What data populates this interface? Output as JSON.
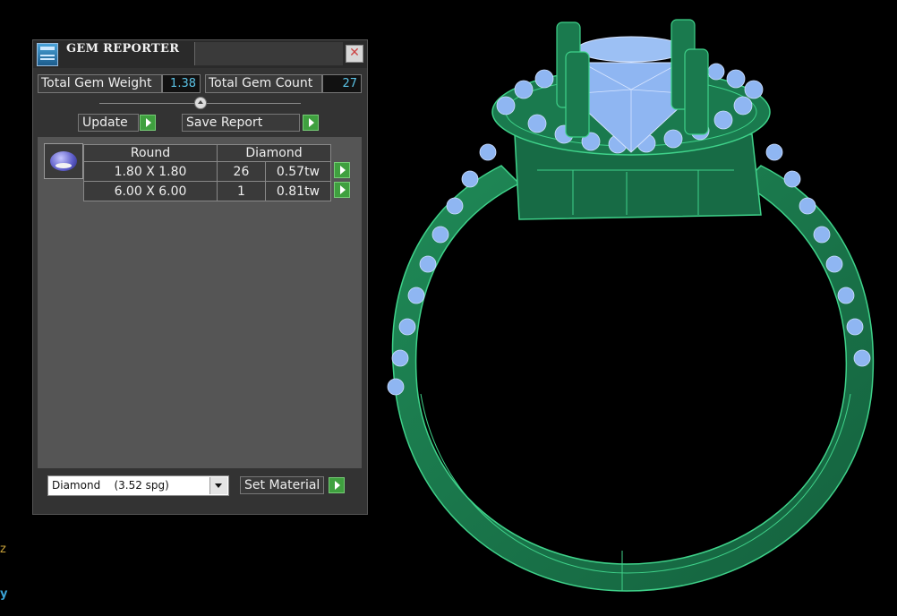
{
  "window": {
    "title": "GEM REPORTER"
  },
  "stats": {
    "total_weight_label": "Total Gem Weight",
    "total_weight_value": "1.38",
    "total_count_label": "Total Gem Count",
    "total_count_value": "27"
  },
  "buttons": {
    "update": "Update",
    "save_report": "Save Report",
    "set_material": "Set Material"
  },
  "table": {
    "header_shape": "Round",
    "header_material": "Diamond",
    "rows": [
      {
        "size": "1.80 X 1.80",
        "count": "26",
        "weight": "0.57tw"
      },
      {
        "size": "6.00 X 6.00",
        "count": "1",
        "weight": "0.81tw"
      }
    ]
  },
  "material_select": {
    "value": "Diamond    (3.52 spg)"
  },
  "axes": {
    "z": "z",
    "y": "y"
  },
  "colors": {
    "metal": "#1e7a4f",
    "metal_edge": "#3fd28a",
    "gem": "#8fb6f2",
    "value_text": "#5bc3e6",
    "go_button": "#3fa03f"
  },
  "icons": [
    "app-icon",
    "close-icon",
    "slider-thumb",
    "gem-thumbnail",
    "go-arrow-icon",
    "dropdown-arrow-icon"
  ]
}
